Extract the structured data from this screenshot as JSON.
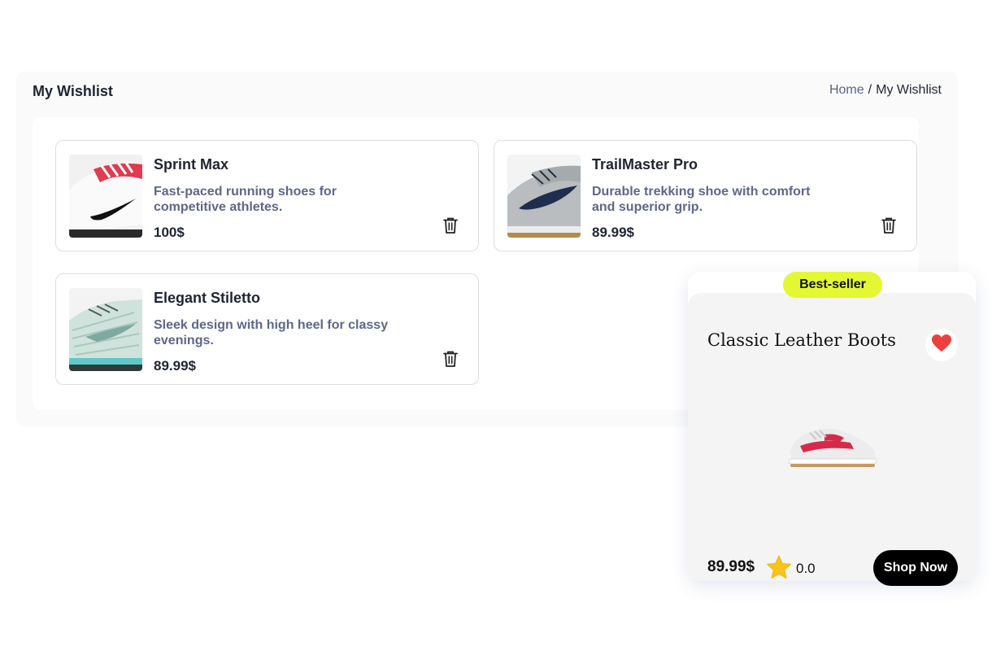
{
  "header": {
    "title": "My Wishlist",
    "breadcrumb": {
      "home": "Home",
      "separator": "/",
      "current": "My Wishlist"
    }
  },
  "wishlist": [
    {
      "name": "Sprint Max",
      "description": "Fast-paced running shoes for competitive athletes.",
      "price": "100$"
    },
    {
      "name": "TrailMaster Pro",
      "description": "Durable trekking shoe with comfort and superior grip.",
      "price": "89.99$"
    },
    {
      "name": "Elegant Stiletto",
      "description": "Sleek design with high heel for classy evenings.",
      "price": "89.99$"
    }
  ],
  "product": {
    "badge": "Best-seller",
    "name": "Classic Leather Boots",
    "price": "89.99$",
    "rating": "0.0",
    "button_label": "Shop Now",
    "favorite": true
  },
  "colors": {
    "badge": "#e4f733",
    "heart": "#ee3f3f",
    "star": "#f9c31b",
    "button": "#000000",
    "description": "#5f6688"
  },
  "icons": [
    "trash-icon",
    "heart-icon",
    "star-icon"
  ]
}
